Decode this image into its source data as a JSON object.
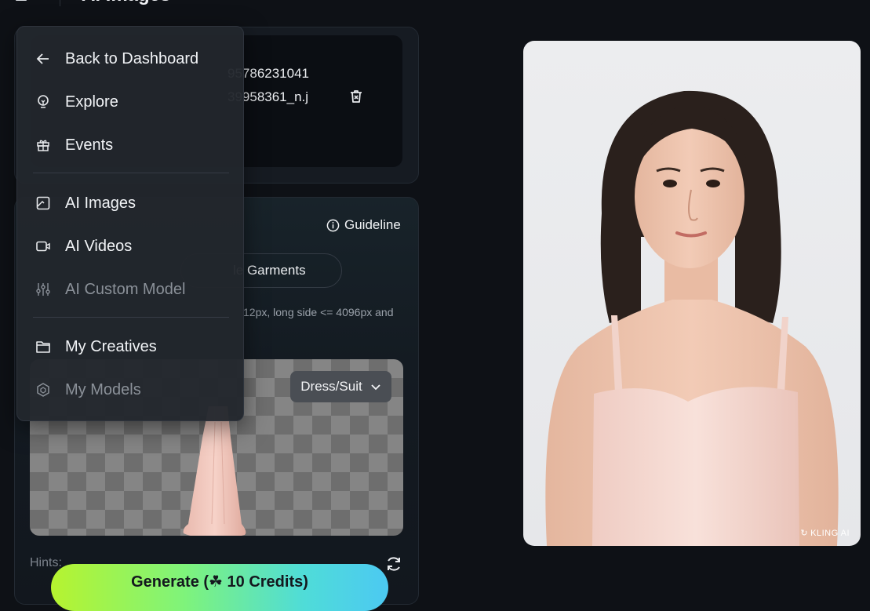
{
  "header": {
    "title": "AI Images"
  },
  "upload_files": [
    {
      "name": "95786231041"
    },
    {
      "name": "39958361_n.j"
    }
  ],
  "garment_panel": {
    "guideline_label": "Guideline",
    "garments_tab_label": "le Garments",
    "requirements_note": "12px, long side <= 4096px and",
    "garment_type_label": "Dress/Suit",
    "hints_label": "Hints:",
    "generate_label": "Generate (☘ 10 Credits)"
  },
  "menu": {
    "items": [
      {
        "label": "Back to Dashboard",
        "icon": "arrow-left-icon"
      },
      {
        "label": "Explore",
        "icon": "lightbulb-icon"
      },
      {
        "label": "Events",
        "icon": "gift-icon"
      },
      {
        "label": "AI Images",
        "icon": "image-icon"
      },
      {
        "label": "AI Videos",
        "icon": "video-camera-icon"
      },
      {
        "label": "AI Custom Model",
        "icon": "sliders-icon"
      },
      {
        "label": "My Creatives",
        "icon": "folder-icon"
      },
      {
        "label": "My Models",
        "icon": "hexagon-cube-icon"
      }
    ]
  },
  "preview": {
    "watermark": "KLING AI"
  },
  "colors": {
    "background": "#0e1116",
    "menu_bg": "#22262d",
    "generate_gradient_start": "#b6f32f",
    "generate_gradient_end": "#4cc9f2"
  }
}
